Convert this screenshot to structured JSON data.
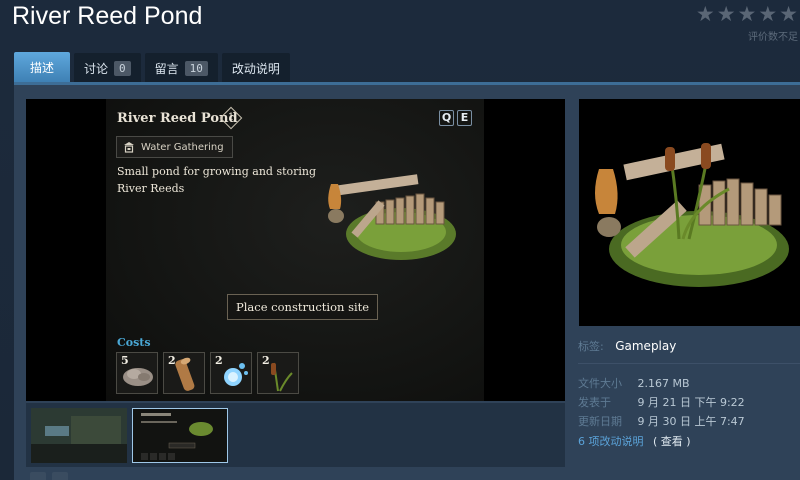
{
  "page": {
    "title": "River Reed Pond",
    "rating_text": "评价数不足",
    "rating_stars": 0
  },
  "tabs": [
    {
      "label": "描述",
      "active": true
    },
    {
      "label": "讨论",
      "count": "0"
    },
    {
      "label": "留言",
      "count": "10"
    },
    {
      "label": "改动说明"
    }
  ],
  "preview": {
    "item_title": "River Reed Pond",
    "tier": "1",
    "keys": [
      "Q",
      "E"
    ],
    "category": "Water Gathering",
    "description": "Small pond for growing and storing River Reeds",
    "action_button": "Place construction site",
    "costs_label": "Costs",
    "costs": [
      {
        "qty": "5",
        "icon": "stone-pile-icon"
      },
      {
        "qty": "2",
        "icon": "wood-log-icon"
      },
      {
        "qty": "2",
        "icon": "water-orbs-icon"
      },
      {
        "qty": "2",
        "icon": "reed-icon"
      }
    ]
  },
  "thumbnails": [
    "screenshot-thumbnail-1",
    "screenshot-thumbnail-2"
  ],
  "details": {
    "tag_label": "标签:",
    "tag_value": "Gameplay",
    "size_label": "文件大小",
    "size_value": "2.167 MB",
    "posted_label": "发表于",
    "posted_value": "9 月 21 日 下午 9:22",
    "updated_label": "更新日期",
    "updated_value": "9 月 30 日 上午 7:47",
    "changes_link": "6 项改动说明",
    "view_link": "( 查看 )"
  },
  "colors": {
    "background": "#1b2838",
    "active_tab": "#4e93c9",
    "costs_accent": "#4aa8d6",
    "link": "#5ba3d9"
  }
}
